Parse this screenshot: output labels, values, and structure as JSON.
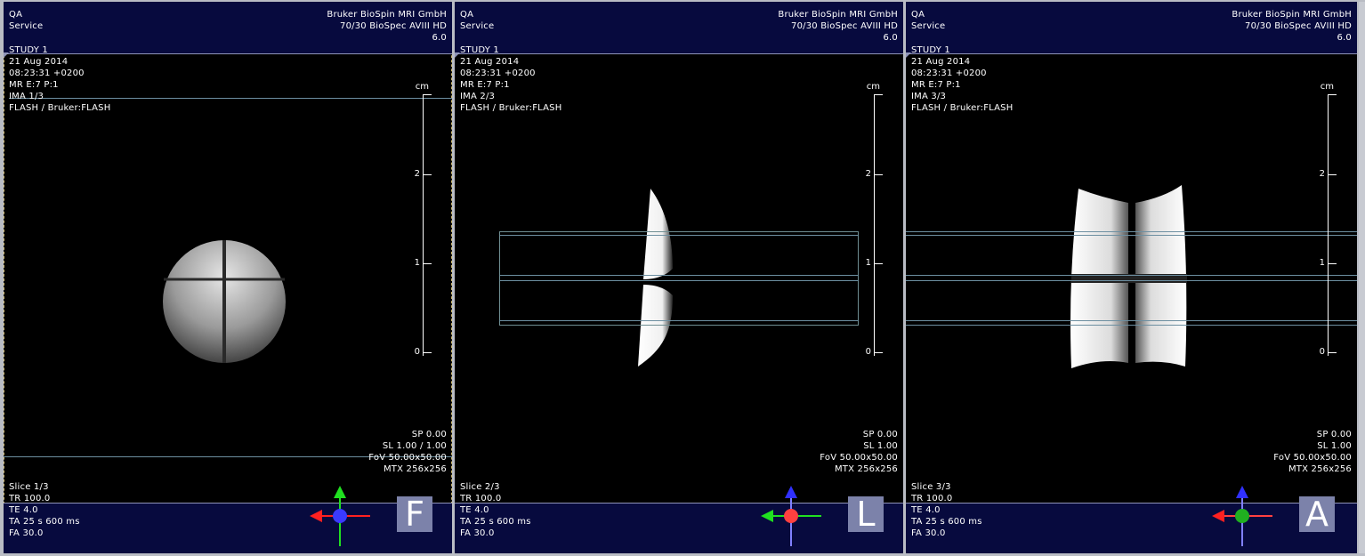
{
  "viewers": [
    {
      "top_left": "QA\nService",
      "top_right": "Bruker BioSpin MRI GmbH\n70/30 BioSpec AVIII HD\n6.0",
      "study": "STUDY 1\n21 Aug 2014\n08:23:31 +0200\nMR E:7 P:1\nIMA 1/3\nFLASH / Bruker:FLASH",
      "params": "SP 0.00\nSL 1.00 / 1.00\nFoV 50.00x50.00\nMTX 256x256",
      "bottom_left": "Slice 1/3\nTR 100.0\nTE 4.0\nTA 25 s 600 ms\nFA 30.0",
      "orientation_letter": "F",
      "ruler_unit": "cm",
      "ruler_ticks": [
        "2",
        "1",
        "0"
      ]
    },
    {
      "top_left": "QA\nService",
      "top_right": "Bruker BioSpin MRI GmbH\n70/30 BioSpec AVIII HD\n6.0",
      "study": "STUDY 1\n21 Aug 2014\n08:23:31 +0200\nMR E:7 P:1\nIMA 2/3\nFLASH / Bruker:FLASH",
      "params": "SP 0.00\nSL 1.00\nFoV 50.00x50.00\nMTX 256x256",
      "bottom_left": "Slice 2/3\nTR 100.0\nTE 4.0\nTA 25 s 600 ms\nFA 30.0",
      "orientation_letter": "L",
      "ruler_unit": "cm",
      "ruler_ticks": [
        "2",
        "1",
        "0"
      ]
    },
    {
      "top_left": "QA\nService",
      "top_right": "Bruker BioSpin MRI GmbH\n70/30 BioSpec AVIII HD\n6.0",
      "study": "STUDY 1\n21 Aug 2014\n08:23:31 +0200\nMR E:7 P:1\nIMA 3/3\nFLASH / Bruker:FLASH",
      "params": "SP 0.00\nSL 1.00\nFoV 50.00x50.00\nMTX 256x256",
      "bottom_left": "Slice 3/3\nTR 100.0\nTE 4.0\nTA 25 s 600 ms\nFA 30.0",
      "orientation_letter": "A",
      "ruler_unit": "cm",
      "ruler_ticks": [
        "2",
        "1",
        "0"
      ]
    }
  ],
  "colors": {
    "band": "#070a3e",
    "axis_red": "#ff2020",
    "axis_green": "#20e020",
    "axis_blue": "#3030ff",
    "orient_box": "#7c82aa",
    "overlay": "#6d8fa1"
  }
}
